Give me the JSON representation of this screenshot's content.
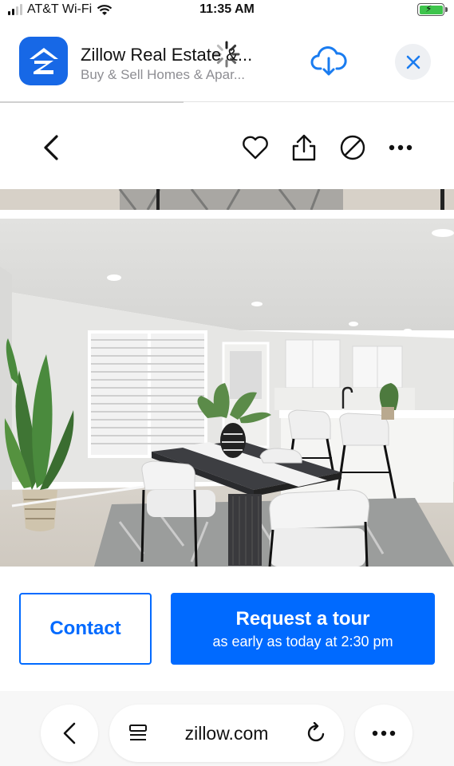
{
  "status_bar": {
    "carrier": "AT&T Wi-Fi",
    "time": "11:35 AM",
    "icons": [
      "signal-icon",
      "wifi-icon",
      "battery-charging-icon"
    ]
  },
  "app_banner": {
    "title": "Zillow Real Estate &...",
    "subtitle": "Buy & Sell Homes & Apar...",
    "icon": "zillow-logo",
    "download_icon": "cloud-download-icon",
    "close_icon": "close-icon",
    "accent_color": "#1768e6"
  },
  "toolbar": {
    "icons": [
      "back-chevron-icon",
      "heart-icon",
      "share-icon",
      "hide-icon",
      "more-icon"
    ]
  },
  "listing_photo": {
    "description_icon": "photo"
  },
  "actions": {
    "contact_label": "Contact",
    "tour_title": "Request a tour",
    "tour_subtitle": "as early as today at 2:30 pm",
    "brand_color": "#006aff"
  },
  "browser_bar": {
    "url": "zillow.com",
    "icons": [
      "back-icon",
      "reader-icon",
      "reload-icon",
      "more-icon"
    ]
  }
}
